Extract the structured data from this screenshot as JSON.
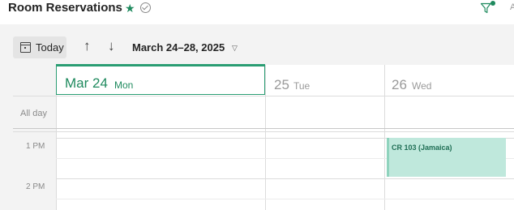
{
  "header": {
    "title": "Room Reservations",
    "star_icon": "star-icon",
    "check_icon": "check-circle-icon",
    "filter_icon": "filter-icon",
    "accent_color": "#1f8a5e"
  },
  "toolbar": {
    "today_label": "Today",
    "up_arrow": "↑",
    "down_arrow": "↓",
    "date_range": "March 24–28, 2025",
    "chevron": "⌄"
  },
  "calendar": {
    "days": [
      {
        "num": "Mar 24",
        "name": "Mon",
        "selected": true
      },
      {
        "num": "25",
        "name": "Tue",
        "selected": false
      },
      {
        "num": "26",
        "name": "Wed",
        "selected": false
      }
    ],
    "all_day_label": "All day",
    "hours": [
      "1 PM",
      "2 PM"
    ],
    "events": [
      {
        "title": "CR 103 (Jamaica)",
        "day": "Wed",
        "start": "1 PM",
        "color": "#bfe8dc"
      }
    ]
  }
}
